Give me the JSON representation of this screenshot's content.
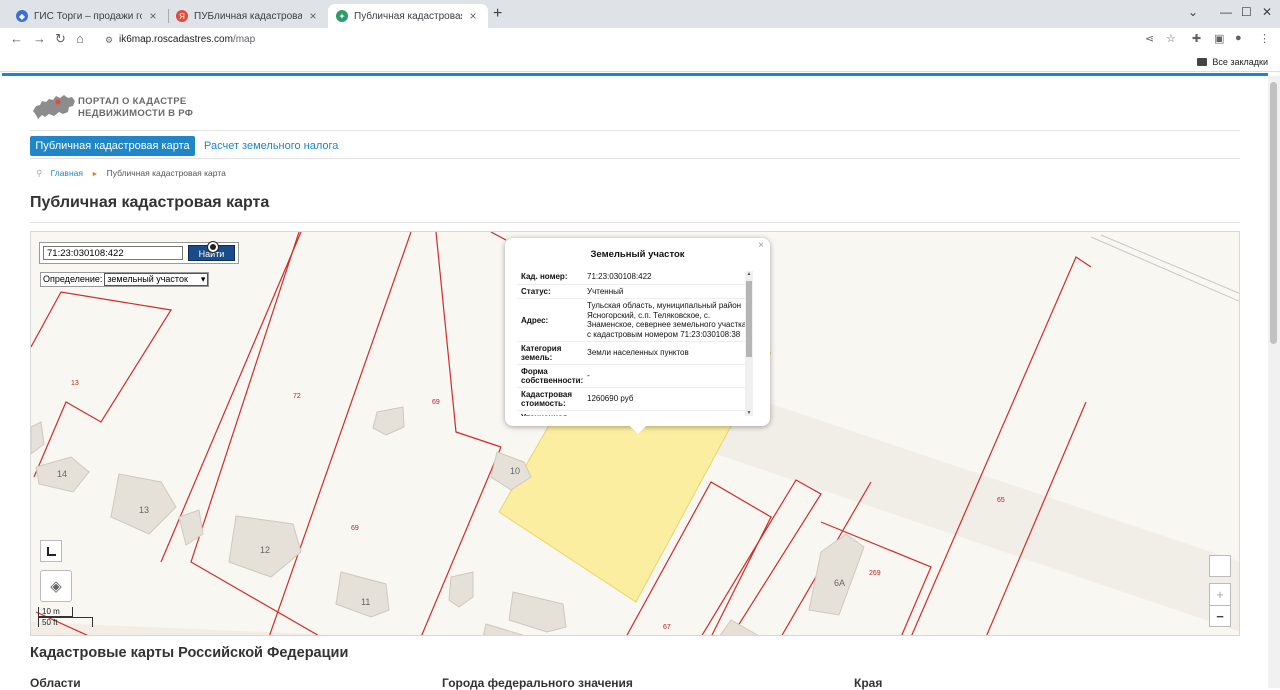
{
  "browser": {
    "tabs": [
      {
        "label": "ГИС Торги – продажи госуд",
        "icon": "gis-torgi-favicon",
        "color": "#3a6fd8"
      },
      {
        "label": "ПУБличная кадастровая ка",
        "icon": "yandex-favicon",
        "color": "#e04b3a"
      },
      {
        "label": "Публичная кадастровая ка",
        "icon": "rosreestr-favicon",
        "color": "#2e9c6a"
      }
    ],
    "close_glyph": "×",
    "new_tab_glyph": "+",
    "url_host": "ik6map.roscadastres.com",
    "url_path": "/map",
    "all_bookmarks": "Все закладки"
  },
  "site": {
    "logo_line1": "ПОРТАЛ О КАДАСТРЕ",
    "logo_line2": "НЕДВИЖИМОСТИ В РФ",
    "nav": {
      "active": "Публичная кадастровая карта",
      "other": "Расчет земельного налога"
    },
    "breadcrumbs": {
      "home": "Главная",
      "current": "Публичная кадастровая карта"
    },
    "page_title": "Публичная кадастровая карта"
  },
  "map": {
    "search_value": "71:23:030108:422",
    "find_label": "Найти",
    "definition_label": "Определение:",
    "definition_value": "земельный участок",
    "zoom_in": "+",
    "zoom_out": "−",
    "scale_m": "10 m",
    "scale_ft": "50 ft",
    "parcel_labels": [
      "13",
      "72",
      "69",
      "69",
      "65",
      "269",
      "67"
    ],
    "house_numbers": [
      "14",
      "13",
      "12",
      "11",
      "10",
      "6А"
    ],
    "popup": {
      "title": "Земельный участок",
      "close": "×",
      "rows": [
        {
          "key": "Кад. номер:",
          "value": "71:23:030108:422"
        },
        {
          "key": "Статус:",
          "value": "Учтенный"
        },
        {
          "key": "Адрес:",
          "value": "Тульская область, муниципальный район Ясногорский, с.п. Теляковское, с. Знаменское, севернее земельного участка с кадастровым номером 71:23:030108:38"
        },
        {
          "key": "Категория земель:",
          "value": "Земли населенных пунктов"
        },
        {
          "key": "Форма собственности:",
          "value": "-"
        },
        {
          "key": "Кадастровая стоимость:",
          "value": "1260690 руб"
        },
        {
          "key": "Уточненная",
          "value": ""
        }
      ]
    }
  },
  "below": {
    "section_title": "Кадастровые карты Российской Федерации",
    "columns": [
      "Области",
      "Города федерального значения",
      "Края"
    ]
  }
}
